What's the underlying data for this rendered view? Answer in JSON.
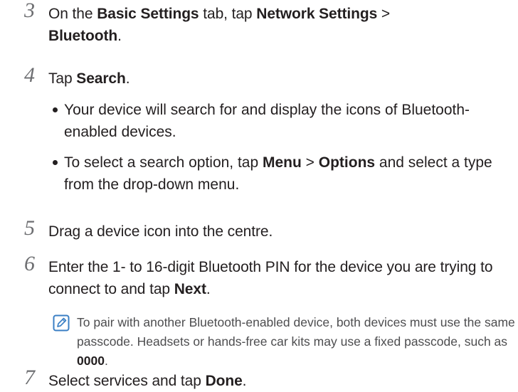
{
  "steps": [
    {
      "number": "3",
      "parts": [
        "On the ",
        "Basic Settings",
        " tab, tap ",
        "Network Settings",
        " >",
        "Bluetooth",
        "."
      ]
    },
    {
      "number": "4",
      "parts": [
        "Tap ",
        "Search",
        "."
      ],
      "bullets": [
        {
          "text": "Your device will search for and display the icons of Bluetooth-enabled devices."
        },
        {
          "parts": [
            "To select a search option, tap ",
            "Menu",
            " > ",
            "Options",
            " and select a type from the drop-down menu."
          ]
        }
      ]
    },
    {
      "number": "5",
      "text": "Drag a device icon into the centre."
    },
    {
      "number": "6",
      "parts": [
        "Enter the 1- to 16-digit Bluetooth PIN for the device you are trying to connect to and tap ",
        "Next",
        "."
      ],
      "note": {
        "icon": "note-pencil-icon",
        "parts": [
          "To pair with another Bluetooth-enabled device, both devices must use the same passcode. Headsets or hands-free car kits may use a fixed passcode, such as ",
          "0000",
          "."
        ]
      }
    },
    {
      "number": "7",
      "parts": [
        "Select services and tap ",
        "Done",
        "."
      ]
    }
  ],
  "colors": {
    "text": "#231f20",
    "step_number": "#6d6e71",
    "note_text": "#4d4d4f",
    "note_icon": "#3a7fc4"
  }
}
